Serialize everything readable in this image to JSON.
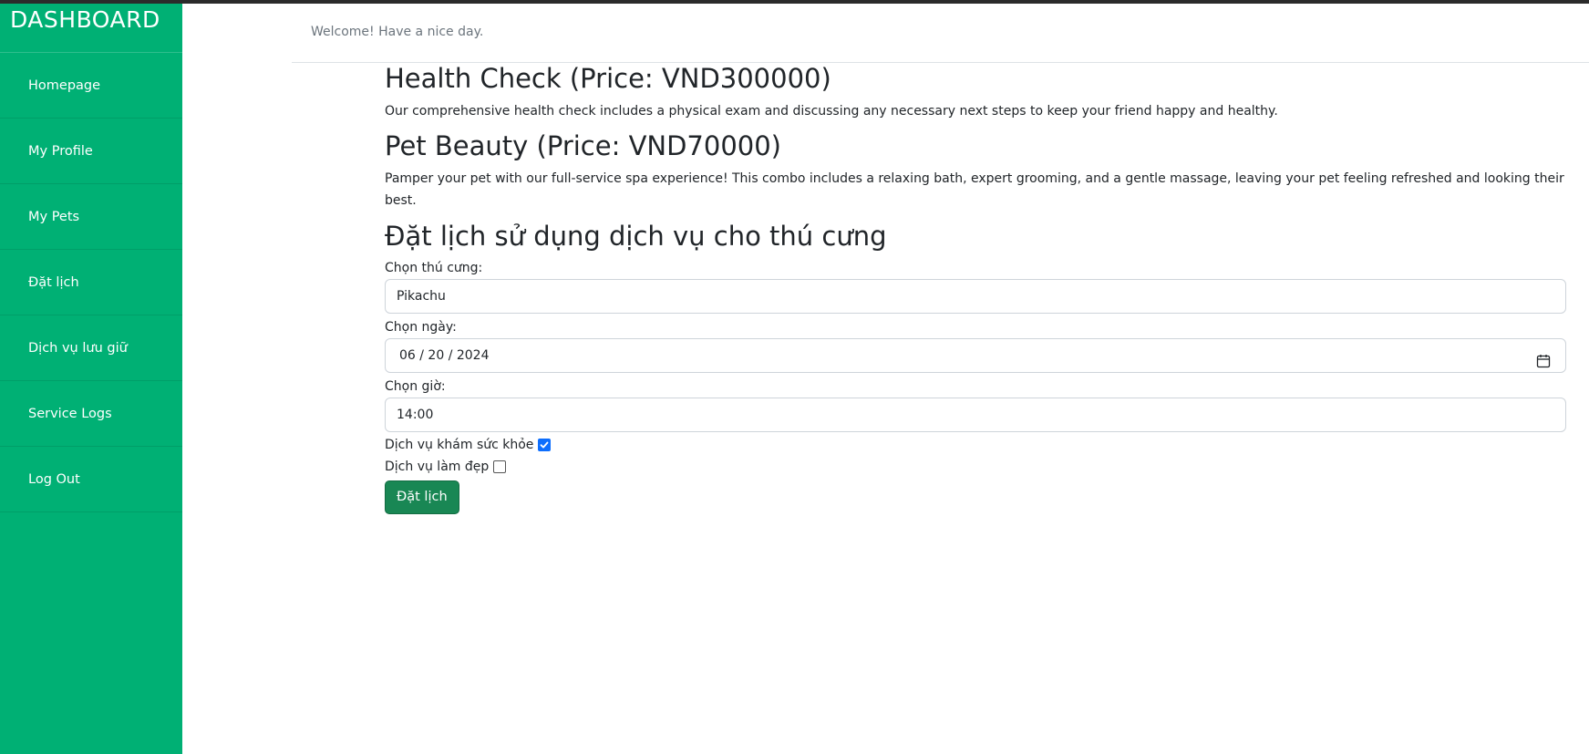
{
  "sidebar": {
    "brand": "DASHBOARD",
    "items": [
      {
        "label": "Homepage"
      },
      {
        "label": "My Profile"
      },
      {
        "label": "My Pets"
      },
      {
        "label": "Đặt lịch"
      },
      {
        "label": "Dịch vụ lưu giữ"
      },
      {
        "label": "Service Logs"
      },
      {
        "label": "Log Out"
      }
    ]
  },
  "header": {
    "welcome": "Welcome! Have a nice day."
  },
  "services": [
    {
      "title": "Health Check (Price: VND300000)",
      "description": "Our comprehensive health check includes a physical exam and discussing any necessary next steps to keep your friend happy and healthy."
    },
    {
      "title": "Pet Beauty (Price: VND70000)",
      "description": "Pamper your pet with our full-service spa experience! This combo includes a relaxing bath, expert grooming, and a gentle massage, leaving your pet feeling refreshed and looking their best."
    }
  ],
  "form": {
    "title": "Đặt lịch sử dụng dịch vụ cho thú cưng",
    "pet_label": "Chọn thú cưng:",
    "pet_value": "Pikachu",
    "date_label": "Chọn ngày:",
    "date_value": "06 / 20 / 2024",
    "time_label": "Chọn giờ:",
    "time_value": "14:00",
    "health_check_label": "Dịch vụ khám sức khỏe",
    "health_check_checked": true,
    "beauty_label": "Dịch vụ làm đẹp",
    "beauty_checked": false,
    "submit_label": "Đặt lịch"
  },
  "colors": {
    "sidebar_bg": "#00b074",
    "button_bg": "#198754",
    "checkbox_checked": "#0d6efd"
  },
  "icons": {
    "date_picker": "calendar-icon"
  }
}
